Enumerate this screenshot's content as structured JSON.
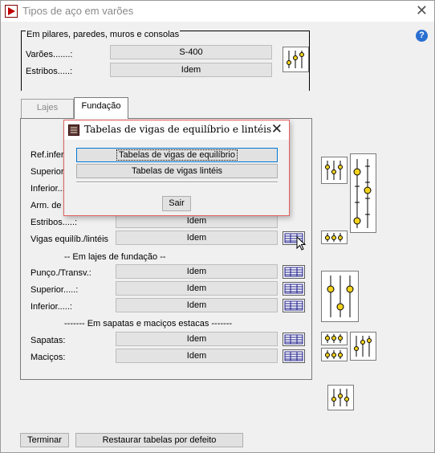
{
  "window": {
    "title": "Tipos de aço em varões"
  },
  "pilares_group": {
    "legend": "Em pilares, paredes, muros e consolas",
    "rows": [
      {
        "label": "Varões.......:",
        "value": "S-400"
      },
      {
        "label": "Estribos.....:",
        "value": "Idem"
      }
    ]
  },
  "tabs": [
    {
      "label": "Lajes"
    },
    {
      "label": "Fundação"
    }
  ],
  "fundacao": {
    "hidden_rows": [
      {
        "label": "Ref.inferi"
      },
      {
        "label": "Superior."
      },
      {
        "label": "Inferior..."
      },
      {
        "label": "Arm. de a"
      }
    ],
    "rows_top": [
      {
        "label": "Estribos.....:",
        "value": "Idem"
      },
      {
        "label": "Vigas equilíb./lintéis",
        "value": "Idem"
      }
    ],
    "section_lajes": "-- Em lajes de fundação --",
    "rows_lajes": [
      {
        "label": "Punço./Transv.:",
        "value": "Idem"
      },
      {
        "label": "Superior.....:",
        "value": "Idem"
      },
      {
        "label": "Inferior.....:",
        "value": "Idem"
      }
    ],
    "section_sapatas": "------- Em sapatas e maciços estacas -------",
    "rows_sapatas": [
      {
        "label": "Sapatas:",
        "value": "Idem"
      },
      {
        "label": "Maciços:",
        "value": "Idem"
      }
    ]
  },
  "buttons": {
    "terminar": "Terminar",
    "restaurar": "Restaurar tabelas por defeito"
  },
  "dialog": {
    "title": "Tabelas de vigas de equilíbrio e lintéis",
    "btn_equilibrio": "Tabelas de vigas de equilíbrio",
    "btn_linteis": "Tabelas de vigas lintéis",
    "sair": "Sair"
  },
  "icons": {
    "app": "app-logo-icon",
    "close": "close-icon",
    "help": "help-icon",
    "table": "table-icon",
    "slider": "slider-icon"
  },
  "help_glyph": "?"
}
